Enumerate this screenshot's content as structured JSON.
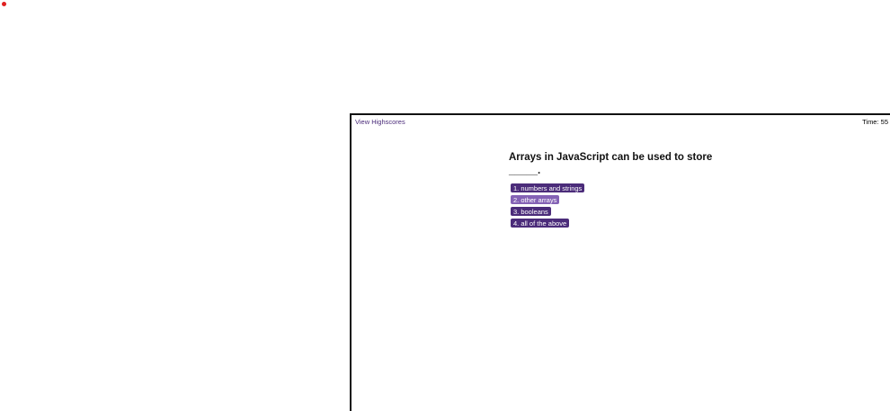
{
  "header": {
    "highscores_link": "View Highscores",
    "timer_label": "Time: 55"
  },
  "quiz": {
    "question_line1": "Arrays in JavaScript can be used to store",
    "question_line2": "_____.",
    "answers": [
      {
        "label": "1. numbers and strings"
      },
      {
        "label": "2. other arrays"
      },
      {
        "label": "3. booleans"
      },
      {
        "label": "4. all of the above"
      }
    ]
  },
  "colors": {
    "accent": "#4b2c7a",
    "accent_hover": "#8462b5",
    "recording_indicator": "#e02020"
  }
}
